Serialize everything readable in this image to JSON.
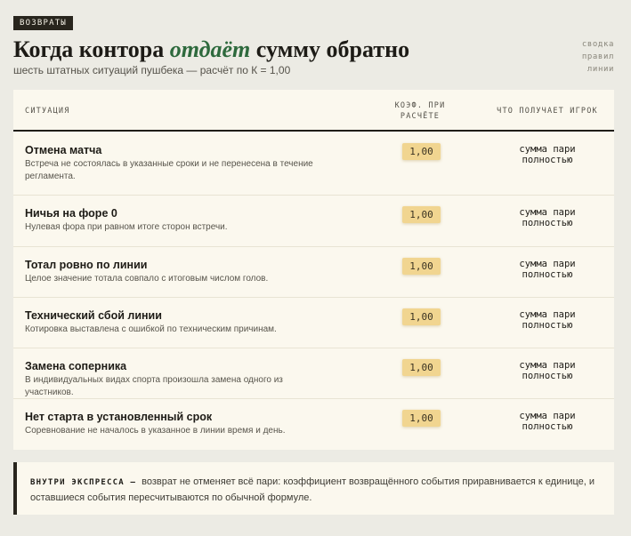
{
  "tag": "ВОЗВРАТЫ",
  "title": {
    "before": "Когда контора ",
    "accent": "отдаёт",
    "after": " сумму обратно"
  },
  "subtitle": "шесть штатных ситуаций пушбека — расчёт по К = 1,00",
  "side_links": [
    "сводка",
    "правил",
    "линии"
  ],
  "table": {
    "headers": {
      "situation": "СИТУАЦИЯ",
      "coef_line1": "КОЭФ. ПРИ",
      "coef_line2": "РАСЧЁТЕ",
      "player_gets": "ЧТО ПОЛУЧАЕТ ИГРОК"
    },
    "rows": [
      {
        "title": "Отмена матча",
        "desc": "Встреча не состоялась в указанные сроки и не перенесена в течение регламента.",
        "coef": "1,00",
        "get1": "сумма пари",
        "get2": "полностью"
      },
      {
        "title": "Ничья на форе 0",
        "desc": "Нулевая фора при равном итоге сторон встречи.",
        "coef": "1,00",
        "get1": "сумма пари",
        "get2": "полностью"
      },
      {
        "title": "Тотал ровно по линии",
        "desc": "Целое значение тотала совпало с итоговым числом голов.",
        "coef": "1,00",
        "get1": "сумма пари",
        "get2": "полностью"
      },
      {
        "title": "Технический сбой линии",
        "desc": "Котировка выставлена с ошибкой по техническим причинам.",
        "coef": "1,00",
        "get1": "сумма пари",
        "get2": "полностью"
      },
      {
        "title": "Замена соперника",
        "desc": "В индивидуальных видах спорта произошла замена одного из участников.",
        "coef": "1,00",
        "get1": "сумма пари",
        "get2": "полностью"
      },
      {
        "title": "Нет старта в установленный срок",
        "desc": "Соревнование не началось в указанное в линии время и день.",
        "coef": "1,00",
        "get1": "сумма пари",
        "get2": "полностью"
      }
    ]
  },
  "note": {
    "label": "ВНУТРИ ЭКСПРЕССА —",
    "text": "возврат не отменяет всё пари: коэффициент возвращённого события приравнивается к единице, и оставшиеся события пересчитываются по обычной формуле."
  }
}
